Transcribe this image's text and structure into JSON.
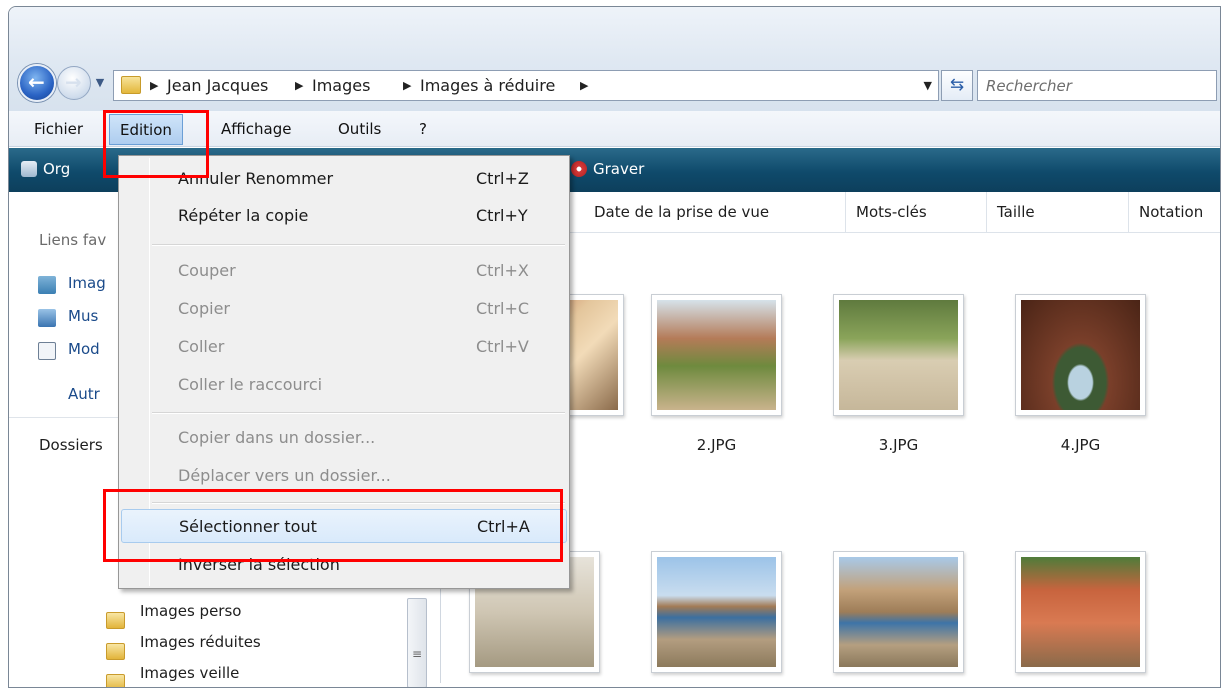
{
  "navigation": {
    "back_icon": "back-arrow-icon",
    "forward_icon": "forward-arrow-icon",
    "breadcrumbs": [
      "Jean Jacques",
      "Images",
      "Images à réduire"
    ],
    "search_placeholder": "Rechercher"
  },
  "menubar": {
    "items": [
      "Fichier",
      "Edition",
      "Affichage",
      "Outils",
      "?"
    ],
    "active": "Edition"
  },
  "toolbar": {
    "organize_label": "Org",
    "burn_label": "Graver"
  },
  "left_pane": {
    "favorites_header": "Liens fav",
    "favorites": [
      "Imag",
      "Mus",
      "Mod",
      "Autr"
    ],
    "folders_header": "Dossiers",
    "folders": [
      "Images perso",
      "Images réduites",
      "Images veille"
    ]
  },
  "columns": [
    "Date de la prise de vue",
    "Mots-clés",
    "Taille",
    "Notation"
  ],
  "thumbnails": [
    {
      "label": ""
    },
    {
      "label": "2.JPG"
    },
    {
      "label": "3.JPG"
    },
    {
      "label": "4.JPG"
    }
  ],
  "edit_menu": {
    "items": [
      {
        "label": "Annuler Renommer",
        "shortcut": "Ctrl+Z",
        "enabled": true
      },
      {
        "label": "Répéter la copie",
        "shortcut": "Ctrl+Y",
        "enabled": true
      },
      {
        "label": "Couper",
        "shortcut": "Ctrl+X",
        "enabled": false
      },
      {
        "label": "Copier",
        "shortcut": "Ctrl+C",
        "enabled": false
      },
      {
        "label": "Coller",
        "shortcut": "Ctrl+V",
        "enabled": false
      },
      {
        "label": "Coller le raccourci",
        "shortcut": "",
        "enabled": false
      },
      {
        "label": "Copier dans un dossier...",
        "shortcut": "",
        "enabled": false
      },
      {
        "label": "Déplacer vers un dossier...",
        "shortcut": "",
        "enabled": false
      },
      {
        "label": "Sélectionner tout",
        "shortcut": "Ctrl+A",
        "enabled": true
      },
      {
        "label": "Inverser la sélection",
        "shortcut": "",
        "enabled": true
      }
    ]
  },
  "colors": {
    "highlight_box": "#ff0000",
    "toolbar_bg": "#0f4a6b"
  }
}
